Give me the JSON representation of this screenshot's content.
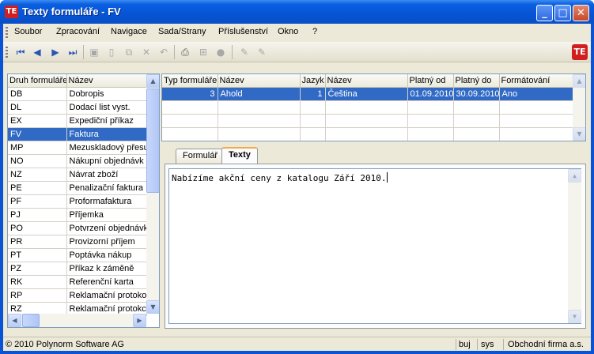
{
  "window": {
    "title": "Texty formuláře - FV",
    "app_icon": "TE",
    "minimize": "minimize-icon",
    "maximize": "maximize-icon",
    "close": "close-icon"
  },
  "menu": [
    "Soubor",
    "Zpracování",
    "Navigace",
    "Sada/Strany",
    "Příslušenství",
    "Okno",
    "?"
  ],
  "left_grid": {
    "columns": [
      "Druh formuláře",
      "Název"
    ],
    "rows": [
      [
        "DB",
        "Dobropis"
      ],
      [
        "DL",
        "Dodací list vyst."
      ],
      [
        "EX",
        "Expediční příkaz"
      ],
      [
        "FV",
        "Faktura"
      ],
      [
        "MP",
        "Mezuskladový přesu"
      ],
      [
        "NO",
        "Nákupní objednávk"
      ],
      [
        "NZ",
        "Návrat zboží"
      ],
      [
        "PE",
        "Penalizační faktura"
      ],
      [
        "PF",
        "Proformafaktura"
      ],
      [
        "PJ",
        "Příjemka"
      ],
      [
        "PO",
        "Potvrzení objednávk"
      ],
      [
        "PR",
        "Provizorní příjem"
      ],
      [
        "PT",
        "Poptávka nákup"
      ],
      [
        "PZ",
        "Příkaz k záměně"
      ],
      [
        "RK",
        "Referenční karta"
      ],
      [
        "RP",
        "Reklamační protokol"
      ],
      [
        "RZ",
        "Reklamační protokc"
      ]
    ],
    "selected_index": 3
  },
  "top_grid": {
    "columns": [
      "Typ formuláře",
      "Název",
      "Jazyk",
      "Název",
      "Platný od",
      "Platný do",
      "Formátování"
    ],
    "rows": [
      [
        "3",
        "Ahold",
        "1",
        "Čeština",
        "01.09.2010",
        "30.09.2010",
        "Ano"
      ]
    ]
  },
  "tabs": [
    "Formulář",
    "Texty"
  ],
  "active_tab": "Texty",
  "text_content": "Nabízíme akční ceny z katalogu Září 2010.",
  "status": {
    "copyright": "© 2010 Polynorm Software AG",
    "cell1": "buj",
    "cell2": "sys",
    "company": "Obchodní firma a.s."
  },
  "colors": {
    "titlebar": "#0754d6",
    "selection": "#316ac5",
    "accent_tab": "#f4a94b",
    "logo": "#d11f1f"
  }
}
